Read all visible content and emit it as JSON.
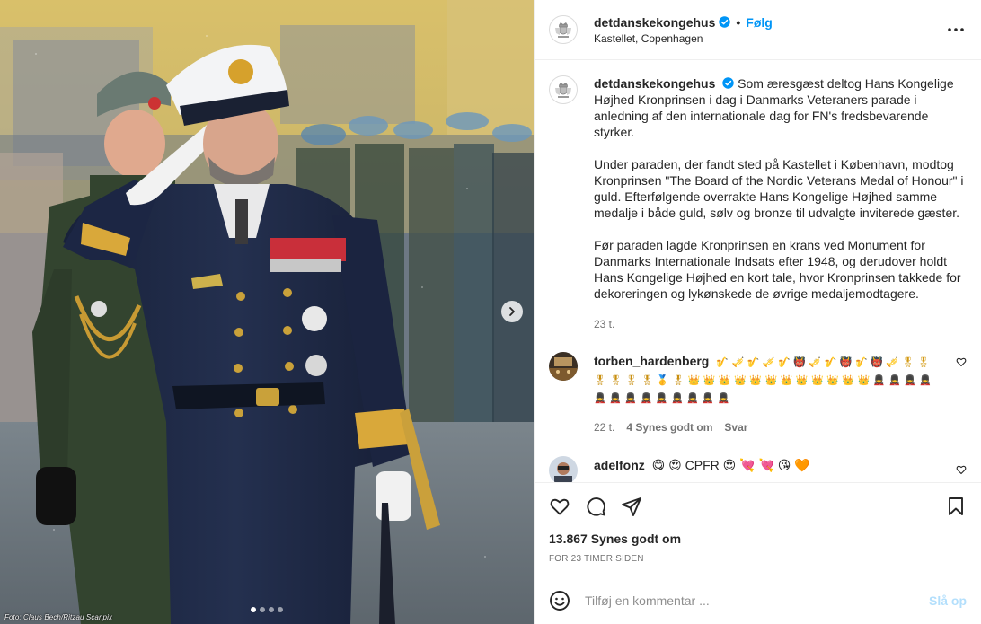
{
  "header": {
    "username": "detdanskekongehus",
    "separator": "•",
    "follow_label": "Følg",
    "location": "Kastellet, Copenhagen",
    "more_icon": "more-horizontal-icon"
  },
  "media": {
    "credit": "Foto: Claus Bech/Ritzau Scanpix",
    "carousel": {
      "count": 4,
      "active_index": 0
    }
  },
  "caption": {
    "username": "detdanskekongehus",
    "paragraphs": [
      "Som æresgæst deltog Hans Kongelige Højhed Kronprinsen i dag i Danmarks Veteraners parade i anledning af den internationale dag for FN's fredsbevarende styrker.",
      "Under paraden, der fandt sted på Kastellet i København, modtog Kronprinsen \"The Board of the Nordic Veterans Medal of Honour\" i guld. Efterfølgende overrakte Hans Kongelige Højhed samme medalje i både guld, sølv og bronze til udvalgte inviterede gæster.",
      "Før paraden lagde Kronprinsen en krans ved Monument for Danmarks Internationale Indsats efter 1948, og derudover holdt Hans Kongelige Højhed en kort tale, hvor Kronprinsen takkede for dekoreringen og lykønskede de øvrige medaljemodtagere."
    ],
    "time_ago": "23 t."
  },
  "comments": [
    {
      "username": "torben_hardenberg",
      "lines": [
        "🎷 🎺 🎷 🎺 🎷 👹 🎺 🎷 👹 🎷 👹 🎺 🎖 🎖",
        "🎖 🎖 🎖 🎖 🥇 🎖 👑 👑 👑 👑 👑 👑 👑 👑 👑 👑 👑 👑 💂 💂 💂 💂",
        "💂 💂 💂 💂 💂 💂 💂 💂 💂"
      ],
      "time_ago": "22 t.",
      "likes": "4 Synes godt om",
      "reply_label": "Svar"
    },
    {
      "username": "adelfonz",
      "text": "😋 😍 CPFR 😍 💘 💘 😘 🧡"
    }
  ],
  "actions": {
    "likes": "13.867 Synes godt om",
    "timestamp": "FOR 23 TIMER SIDEN"
  },
  "add_comment": {
    "placeholder": "Tilføj en kommentar ...",
    "post_label": "Slå op"
  },
  "colors": {
    "accent": "#0095f6",
    "post_disabled": "#b3dffc",
    "muted": "#737373",
    "border": "#efefef"
  }
}
